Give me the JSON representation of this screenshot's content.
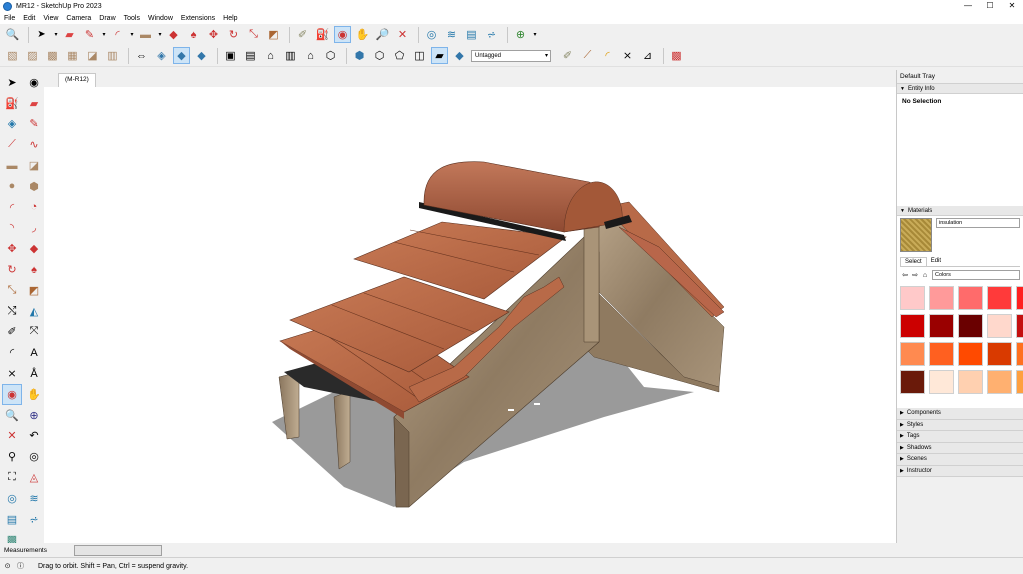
{
  "window": {
    "title": "MR12 - SketchUp Pro 2023",
    "controls": [
      "—",
      "☐",
      "✕"
    ]
  },
  "menu": [
    "File",
    "Edit",
    "View",
    "Camera",
    "Draw",
    "Tools",
    "Window",
    "Extensions",
    "Help"
  ],
  "toolbar": {
    "tag_select": "Untagged",
    "row1_icons": [
      "search-icon",
      "select-arrow-icon",
      "eraser-icon",
      "pencil-line-icon",
      "arc-icon",
      "rectangle-icon",
      "push-pull-icon",
      "follow-me-icon",
      "move-icon",
      "rotate-icon",
      "scale-icon",
      "offset-icon",
      "tape-measure-icon",
      "paint-bucket-icon",
      "orbit-icon",
      "pan-icon",
      "zoom-icon",
      "zoom-extents-icon",
      "sandbox-icon",
      "sandbox-smoove-icon",
      "sandbox-stamp-icon",
      "sandbox-drape-icon",
      "geo-location-icon"
    ],
    "row2_icons": [
      "component-icon",
      "group-icon",
      "material-icon",
      "box-icon",
      "section-plane-icon",
      "dimension-icon",
      "text-icon",
      "axes-icon",
      "3d-text-icon",
      "iso-view-icon",
      "top-view-icon",
      "front-view-icon",
      "right-view-icon",
      "back-view-icon",
      "left-view-icon",
      "x-ray-icon",
      "back-edges-icon",
      "wireframe-icon",
      "hidden-line-icon",
      "shaded-icon",
      "shaded-texture-icon",
      "monochrome-icon",
      "paint-icon",
      "measure-icon",
      "protractor-icon",
      "axis-icon",
      "extension-warehouse-icon"
    ]
  },
  "left_tools": [
    "select-icon",
    "orbit-icon",
    "paint-bucket-icon",
    "eraser-icon",
    "component-icon",
    "pencil-icon",
    "line-icon",
    "freehand-icon",
    "rectangle-icon",
    "rotated-rectangle-icon",
    "circle-icon",
    "polygon-icon",
    "arc-icon",
    "pie-icon",
    "3pt-arc-icon",
    "2pt-arc-icon",
    "move-icon",
    "push-pull-icon",
    "rotate-icon",
    "follow-me-icon",
    "scale-icon",
    "offset-icon",
    "select-all-icon",
    "outer-shell-icon",
    "tape-measure-icon",
    "dimension-icon",
    "protractor-icon",
    "text-icon",
    "axes-icon",
    "3d-text-icon",
    "orbit-active-icon",
    "pan-icon",
    "zoom-icon",
    "zoom-window-icon",
    "zoom-extents-icon",
    "previous-view-icon",
    "position-camera-icon",
    "look-around-icon",
    "walk-icon",
    "section-plane-icon",
    "sandbox-from-contours-icon",
    "sandbox-from-scratch-icon",
    "stamp-icon",
    "drape-icon",
    "extension-warehouse-icon"
  ],
  "scene_tab": "(M-R12)",
  "tray": {
    "title": "Default Tray",
    "entity_info": {
      "header": "Entity Info",
      "selection": "No Selection"
    },
    "materials": {
      "header": "Materials",
      "current_name": "insulation",
      "tabs": [
        "Select",
        "Edit"
      ],
      "library": "Colors",
      "swatches": [
        "#ffc9c9",
        "#ff9a9a",
        "#ff6b6b",
        "#ff3a3a",
        "#ff2020",
        "#cc0000",
        "#9a0000",
        "#6a0000",
        "#ffd8cc",
        "#c41010",
        "#ff8a50",
        "#ff6020",
        "#ff4a00",
        "#d93a00",
        "#ff7020",
        "#6a1a0a",
        "#ffe8d8",
        "#ffd0b0",
        "#ffb070",
        "#ffa040"
      ]
    },
    "collapsed_panels": [
      "Components",
      "Styles",
      "Tags",
      "Shadows",
      "Scenes",
      "Instructor"
    ]
  },
  "status": {
    "measurements_label": "Measurements",
    "hint": "Drag to orbit. Shift = Pan, Ctrl = suspend gravity."
  }
}
